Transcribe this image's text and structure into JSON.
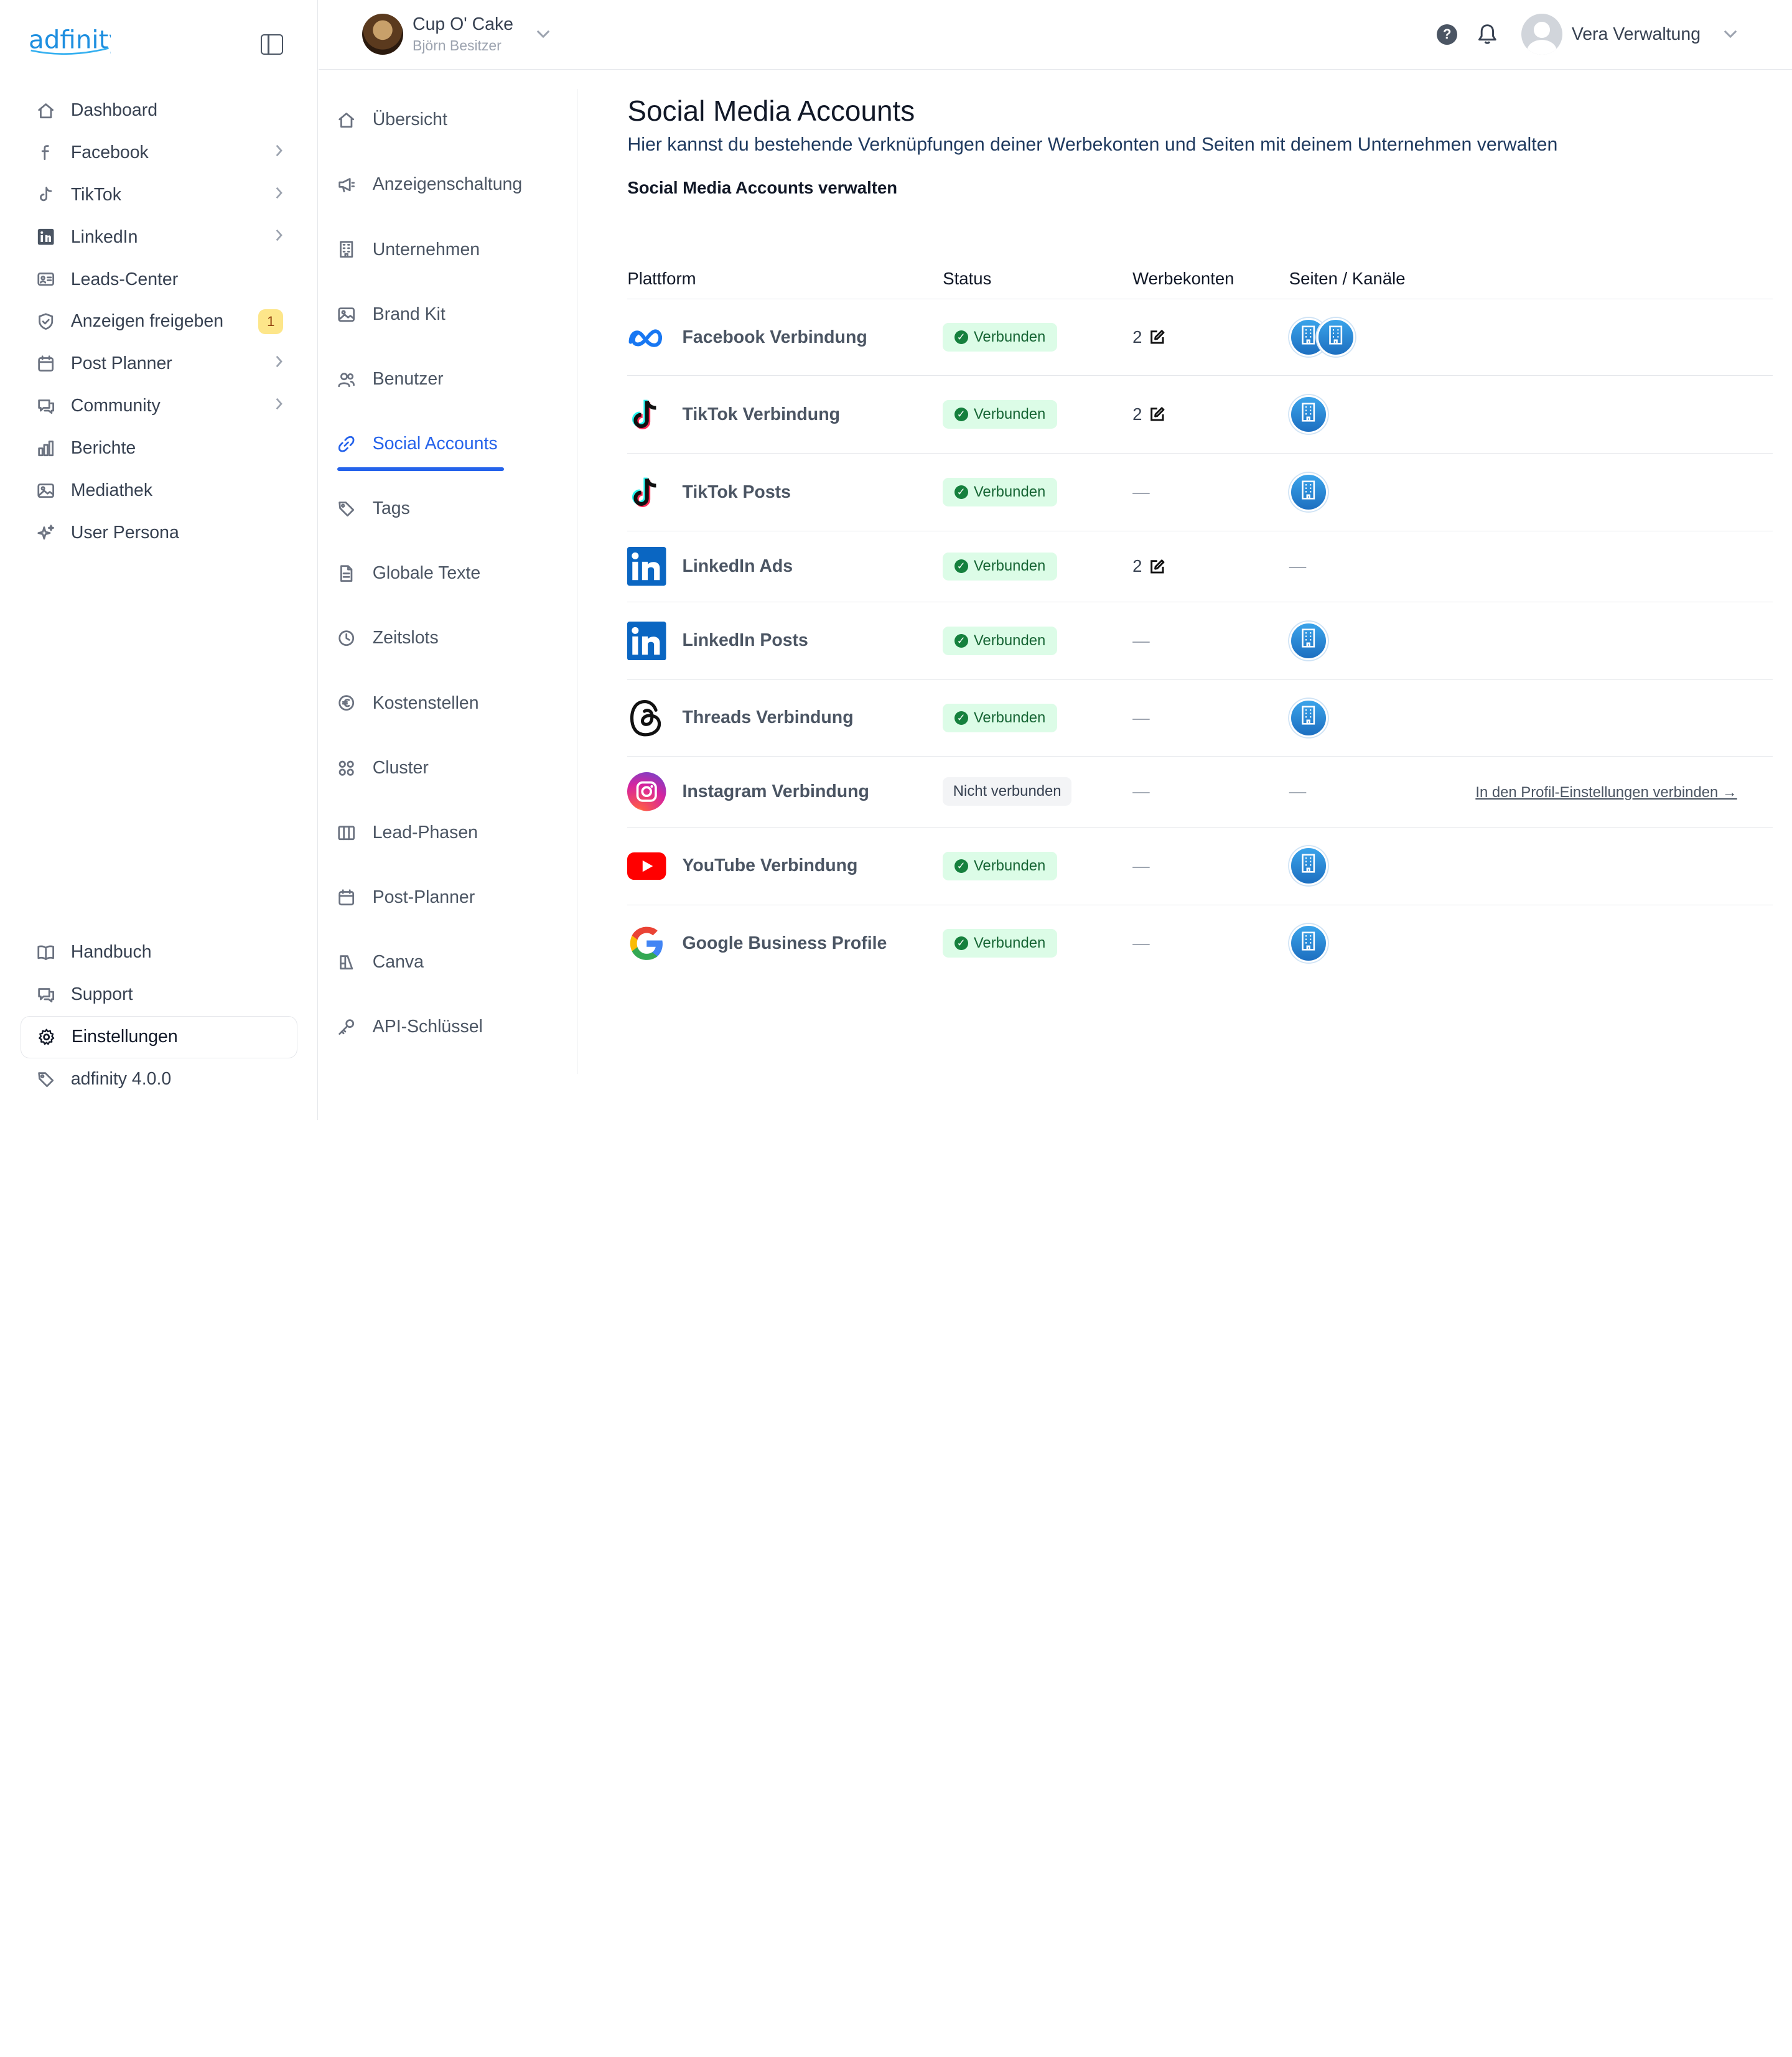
{
  "app": {
    "logo_text": "adfinity"
  },
  "sidebar": {
    "items": [
      {
        "label": "Dashboard",
        "icon": "home-icon",
        "chevron": false
      },
      {
        "label": "Facebook",
        "icon": "facebook-icon",
        "chevron": true
      },
      {
        "label": "TikTok",
        "icon": "tiktok-icon",
        "chevron": true
      },
      {
        "label": "LinkedIn",
        "icon": "linkedin-icon",
        "chevron": true
      },
      {
        "label": "Leads-Center",
        "icon": "contact-card-icon",
        "chevron": false
      },
      {
        "label": "Anzeigen freigeben",
        "icon": "shield-check-icon",
        "chevron": false,
        "badge": "1"
      },
      {
        "label": "Post Planner",
        "icon": "calendar-icon",
        "chevron": true
      },
      {
        "label": "Community",
        "icon": "chat-icon",
        "chevron": true
      },
      {
        "label": "Berichte",
        "icon": "bar-chart-icon",
        "chevron": false
      },
      {
        "label": "Mediathek",
        "icon": "image-icon",
        "chevron": false
      },
      {
        "label": "User Persona",
        "icon": "sparkles-icon",
        "chevron": false
      }
    ],
    "bottom_items": [
      {
        "label": "Handbuch",
        "icon": "book-icon"
      },
      {
        "label": "Support",
        "icon": "chat-icon"
      },
      {
        "label": "Einstellungen",
        "icon": "gear-icon",
        "active": true
      },
      {
        "label": "adfinity 4.0.0",
        "icon": "tag-icon"
      }
    ]
  },
  "topbar": {
    "company_name": "Cup O' Cake",
    "company_owner": "Björn Besitzer",
    "user_name": "Vera Verwaltung",
    "help_symbol": "?"
  },
  "settings_nav": [
    {
      "label": "Übersicht",
      "icon": "home-icon"
    },
    {
      "label": "Anzeigenschaltung",
      "icon": "megaphone-icon"
    },
    {
      "label": "Unternehmen",
      "icon": "building-icon"
    },
    {
      "label": "Brand Kit",
      "icon": "image-icon"
    },
    {
      "label": "Benutzer",
      "icon": "users-icon"
    },
    {
      "label": "Social Accounts",
      "icon": "link-icon",
      "active": true
    },
    {
      "label": "Tags",
      "icon": "tag-icon"
    },
    {
      "label": "Globale Texte",
      "icon": "document-icon"
    },
    {
      "label": "Zeitslots",
      "icon": "clock-icon"
    },
    {
      "label": "Kostenstellen",
      "icon": "euro-icon"
    },
    {
      "label": "Cluster",
      "icon": "grid-icon"
    },
    {
      "label": "Lead-Phasen",
      "icon": "columns-icon"
    },
    {
      "label": "Post-Planner",
      "icon": "calendar-icon"
    },
    {
      "label": "Canva",
      "icon": "canva-icon"
    },
    {
      "label": "API-Schlüssel",
      "icon": "key-icon"
    }
  ],
  "main": {
    "title": "Social Media Accounts",
    "subtitle": "Hier kannst du bestehende Verknüpfungen deiner Werbekonten und Seiten mit deinem Unternehmen verwalten",
    "section_title": "Social Media Accounts verwalten"
  },
  "table": {
    "headers": {
      "platform": "Plattform",
      "status": "Status",
      "werbekonten": "Werbekonten",
      "seiten": "Seiten / Kanäle"
    },
    "rows": [
      {
        "platform": "Facebook Verbindung",
        "icon": "meta-icon",
        "status": "Verbunden",
        "connected": true,
        "werbekonten": "2",
        "pages": 2
      },
      {
        "platform": "TikTok Verbindung",
        "icon": "tiktok-icon",
        "status": "Verbunden",
        "connected": true,
        "werbekonten": "2",
        "pages": 1
      },
      {
        "platform": "TikTok Posts",
        "icon": "tiktok-icon",
        "status": "Verbunden",
        "connected": true,
        "werbekonten": "—",
        "pages": 1
      },
      {
        "platform": "LinkedIn Ads",
        "icon": "linkedin-icon",
        "status": "Verbunden",
        "connected": true,
        "werbekonten": "2",
        "pages": 0,
        "pages_text": "—"
      },
      {
        "platform": "LinkedIn Posts",
        "icon": "linkedin-icon",
        "status": "Verbunden",
        "connected": true,
        "werbekonten": "—",
        "pages": 1
      },
      {
        "platform": "Threads Verbindung",
        "icon": "threads-icon",
        "status": "Verbunden",
        "connected": true,
        "werbekonten": "—",
        "pages": 1
      },
      {
        "platform": "Instagram Verbindung",
        "icon": "instagram-icon",
        "status": "Nicht verbunden",
        "connected": false,
        "werbekonten": "—",
        "pages": 0,
        "pages_text": "—",
        "action": "In den Profil-Einstellungen verbinden →"
      },
      {
        "platform": "YouTube Verbindung",
        "icon": "youtube-icon",
        "status": "Verbunden",
        "connected": true,
        "werbekonten": "—",
        "pages": 1
      },
      {
        "platform": "Google Business Profile",
        "icon": "google-icon",
        "status": "Verbunden",
        "connected": true,
        "werbekonten": "—",
        "pages": 1
      }
    ]
  },
  "colors": {
    "accent": "#2563eb",
    "brand": "#1e8fe0",
    "success_bg": "#dcfce7",
    "success_text": "#166534"
  }
}
